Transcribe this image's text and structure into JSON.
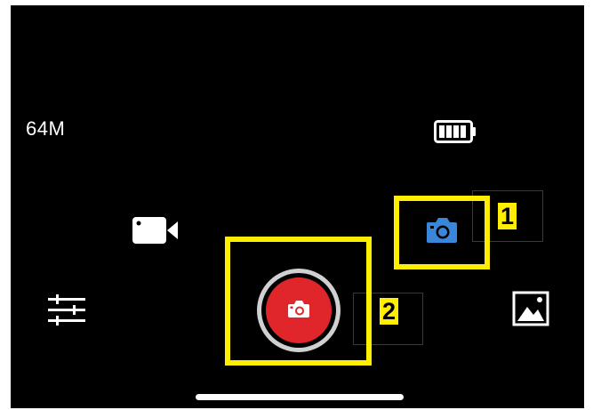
{
  "status": {
    "storage_label": "64M",
    "battery_icon": "battery-full-icon"
  },
  "controls": {
    "video_mode_icon": "video-camera-icon",
    "photo_mode_icon": "photo-camera-icon",
    "shutter_icon": "camera-shutter-icon",
    "settings_icon": "sliders-icon",
    "gallery_icon": "gallery-image-icon"
  },
  "annotations": {
    "label_1": "1",
    "label_2": "2"
  },
  "colors": {
    "background": "#000000",
    "shutter_red": "#e0262b",
    "photo_mode_blue": "#3a86d9",
    "highlight_yellow": "#ffee00"
  }
}
